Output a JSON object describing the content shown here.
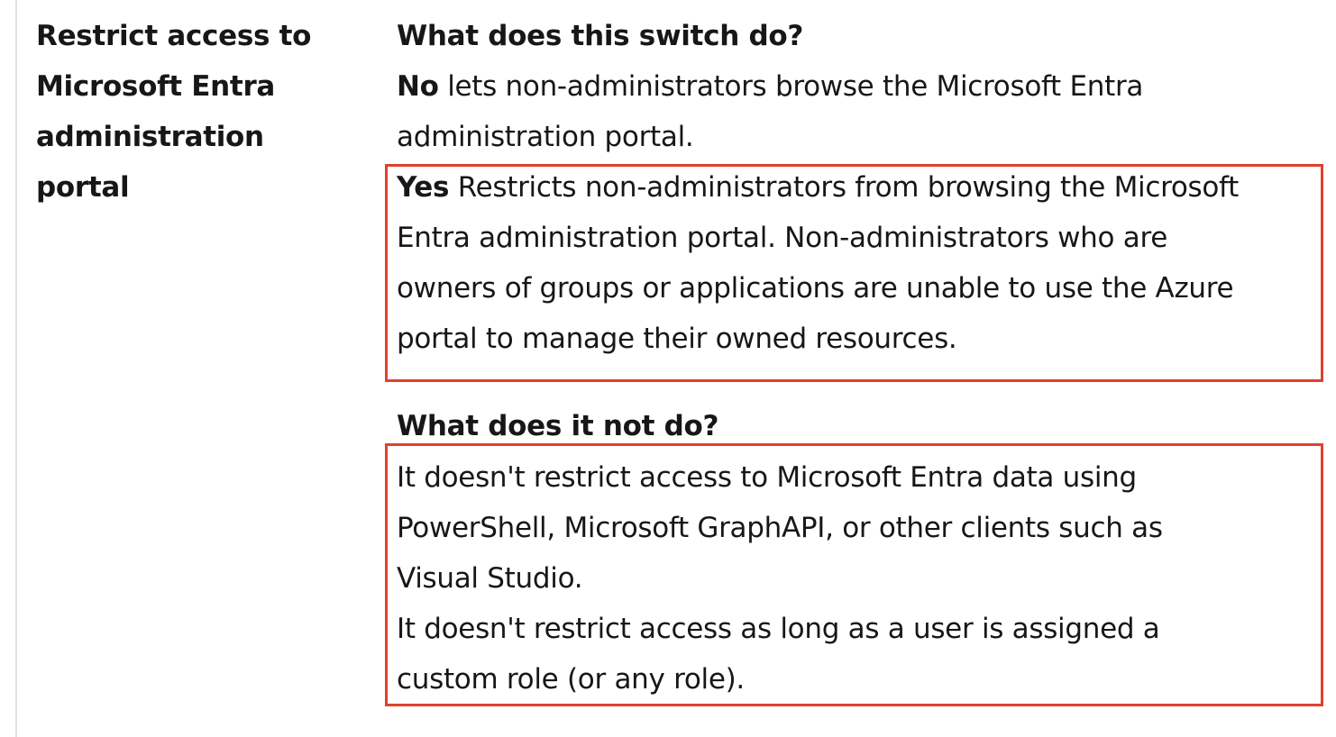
{
  "setting": {
    "name_lines": [
      "Restrict access to",
      "Microsoft Entra",
      "administration",
      "portal"
    ]
  },
  "what_it_does": {
    "heading": "What does this switch do?",
    "no_keyword": "No",
    "no_line_1": " lets non-administrators browse the Microsoft Entra",
    "no_line_2": "administration portal.",
    "yes_keyword": "Yes",
    "yes_line_1": " Restricts non-administrators from browsing the Microsoft",
    "yes_line_2": "Entra administration portal. Non-administrators who are",
    "yes_line_3": "owners of groups or applications are unable to use the Azure",
    "yes_line_4": "portal to manage their owned resources."
  },
  "what_it_does_not_do": {
    "heading": "What does it not do?",
    "line_1": "It doesn't restrict access to Microsoft Entra data using",
    "line_2": "PowerShell, Microsoft GraphAPI, or other clients such as",
    "line_3": "Visual Studio.",
    "line_4": "It doesn't restrict access as long as a user is assigned a",
    "line_5": "custom role (or any role)."
  },
  "colors": {
    "highlight_border": "#e0412e",
    "text": "#171717",
    "rule": "#e1e1e1"
  }
}
